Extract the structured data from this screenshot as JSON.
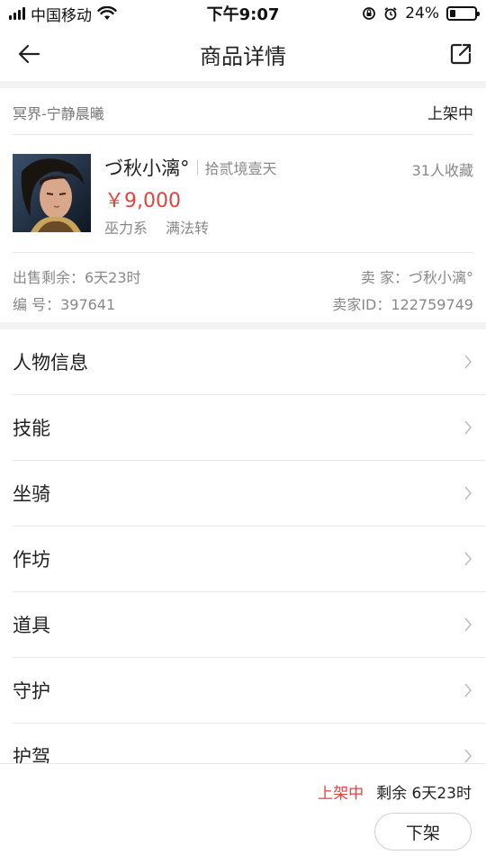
{
  "status_bar": {
    "carrier": "中国移动",
    "time": "下午9:07",
    "battery": "24%",
    "battery_level": 0.24
  },
  "nav": {
    "title": "商品详情"
  },
  "server_row": {
    "server": "冥界-宁静晨曦",
    "status": "上架中"
  },
  "product": {
    "role_name": "づ秋小漓°",
    "role_server": "拾贰境壹天",
    "favorites": "31人收藏",
    "price": "￥9,000",
    "tags": [
      "巫力系",
      "满法转"
    ]
  },
  "meta": {
    "remaining_label": "出售剩余：6天23时",
    "seller_label": "卖 家：づ秋小漓°",
    "id_label": "编 号：397641",
    "seller_id_label": "卖家ID：122759749"
  },
  "menu": [
    {
      "label": "人物信息"
    },
    {
      "label": "技能"
    },
    {
      "label": "坐骑"
    },
    {
      "label": "作坊"
    },
    {
      "label": "道具"
    },
    {
      "label": "守护"
    },
    {
      "label": "护驾"
    }
  ],
  "bottom_bar": {
    "status": "上架中",
    "remaining": "剩余 6天23时",
    "delist_button": "下架"
  },
  "colors": {
    "accent_red": "#e2443c",
    "text_primary": "#222222",
    "text_secondary": "#888888"
  },
  "icons": {
    "back": "arrow-left-icon",
    "share": "share-external-icon",
    "chevron": "chevron-right-icon"
  }
}
